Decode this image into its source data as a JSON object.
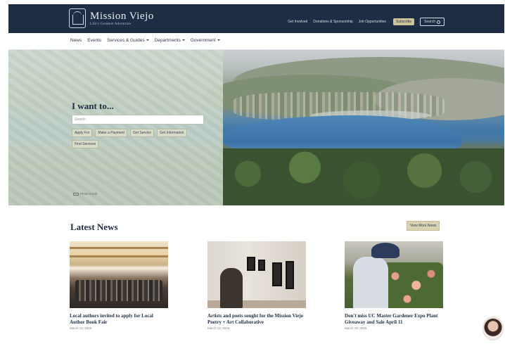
{
  "header": {
    "logo_name": "Mission Viejo",
    "logo_tagline": "Life's Greatest Adventure",
    "util_links": [
      "Get Involved",
      "Donations & Sponsorship",
      "Job Opportunities"
    ],
    "subscribe_label": "Subscribe",
    "search_label": "Search"
  },
  "nav": {
    "items": [
      {
        "label": "News",
        "has_menu": false
      },
      {
        "label": "Events",
        "has_menu": false
      },
      {
        "label": "Services & Guides",
        "has_menu": true
      },
      {
        "label": "Departments",
        "has_menu": true
      },
      {
        "label": "Government",
        "has_menu": true
      }
    ]
  },
  "hero": {
    "title": "I want to...",
    "search_placeholder": "Search",
    "quick_links": [
      "Apply For",
      "Make a Payment",
      "Get Service",
      "Get Information",
      "Find Services"
    ],
    "photo_credit": "Photo credit"
  },
  "news": {
    "title": "Latest News",
    "view_more_label": "View More News",
    "articles": [
      {
        "headline": "Local authors invited to apply for Local Author Book Fair",
        "date": "March 12, 2026"
      },
      {
        "headline": "Artists and poets sought for the Mission Viejo Poetry + Art Collaborative",
        "date": "March 12, 2026"
      },
      {
        "headline": "Don't miss UC Master Gardener Expo Plant Giveaway and Sale April 11",
        "date": "March 10, 2026"
      }
    ]
  },
  "colors": {
    "header_bg": "#1f2d44",
    "accent": "#cfc39a",
    "hero_overlay": "#c9d6c8",
    "heading": "#1f2d44"
  },
  "icons": {
    "logo": "mission-building-icon",
    "search": "search-icon",
    "chat": "chat-avatar"
  }
}
